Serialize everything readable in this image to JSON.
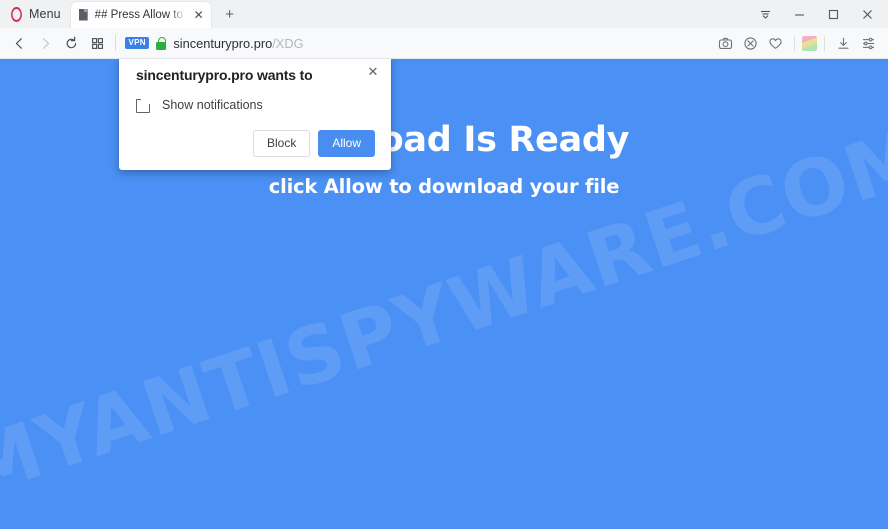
{
  "browser": {
    "menu_label": "Menu",
    "logo_icon": "opera-logo",
    "tabs": [
      {
        "title": "## Press Allow to Do",
        "favicon": "document-icon",
        "close_glyph": "✕"
      }
    ],
    "new_tab_glyph": "+",
    "window_controls": [
      {
        "name": "tab-list-button",
        "glyph": "tab-list-icon"
      },
      {
        "name": "minimize-button",
        "glyph": "minimize-icon"
      },
      {
        "name": "maximize-button",
        "glyph": "maximize-icon"
      },
      {
        "name": "close-button",
        "glyph": "close-icon"
      }
    ],
    "nav": {
      "back_icon": "back-arrow-icon",
      "forward_icon": "forward-arrow-icon",
      "reload_icon": "reload-icon",
      "speeddial_icon": "grid-apps-icon"
    },
    "address": {
      "vpn_badge": "VPN",
      "lock_icon": "green-lock-icon",
      "host": "sincenturypro.pro",
      "path": "/XDG"
    },
    "toolbar_right": [
      {
        "name": "snapshot-button",
        "icon": "camera-icon"
      },
      {
        "name": "ad-blocker-button",
        "icon": "blocked-circle-icon"
      },
      {
        "name": "heart-button",
        "icon": "heart-icon"
      },
      {
        "name": "extension-button",
        "icon": "extension-cube-icon"
      },
      {
        "name": "downloads-button",
        "icon": "download-icon"
      },
      {
        "name": "easy-setup-button",
        "icon": "sliders-icon"
      }
    ]
  },
  "page": {
    "headline": "Download Is Ready",
    "subhead": "click Allow to download your file",
    "watermark": "MYANTISPYWARE.COM",
    "background_color": "#4a90f5"
  },
  "dialog": {
    "title": "sincenturypro.pro wants to",
    "permission_icon": "notification-bell-icon",
    "permission_label": "Show notifications",
    "close_glyph": "✕",
    "block_label": "Block",
    "allow_label": "Allow",
    "allow_color": "#4a8df0"
  }
}
